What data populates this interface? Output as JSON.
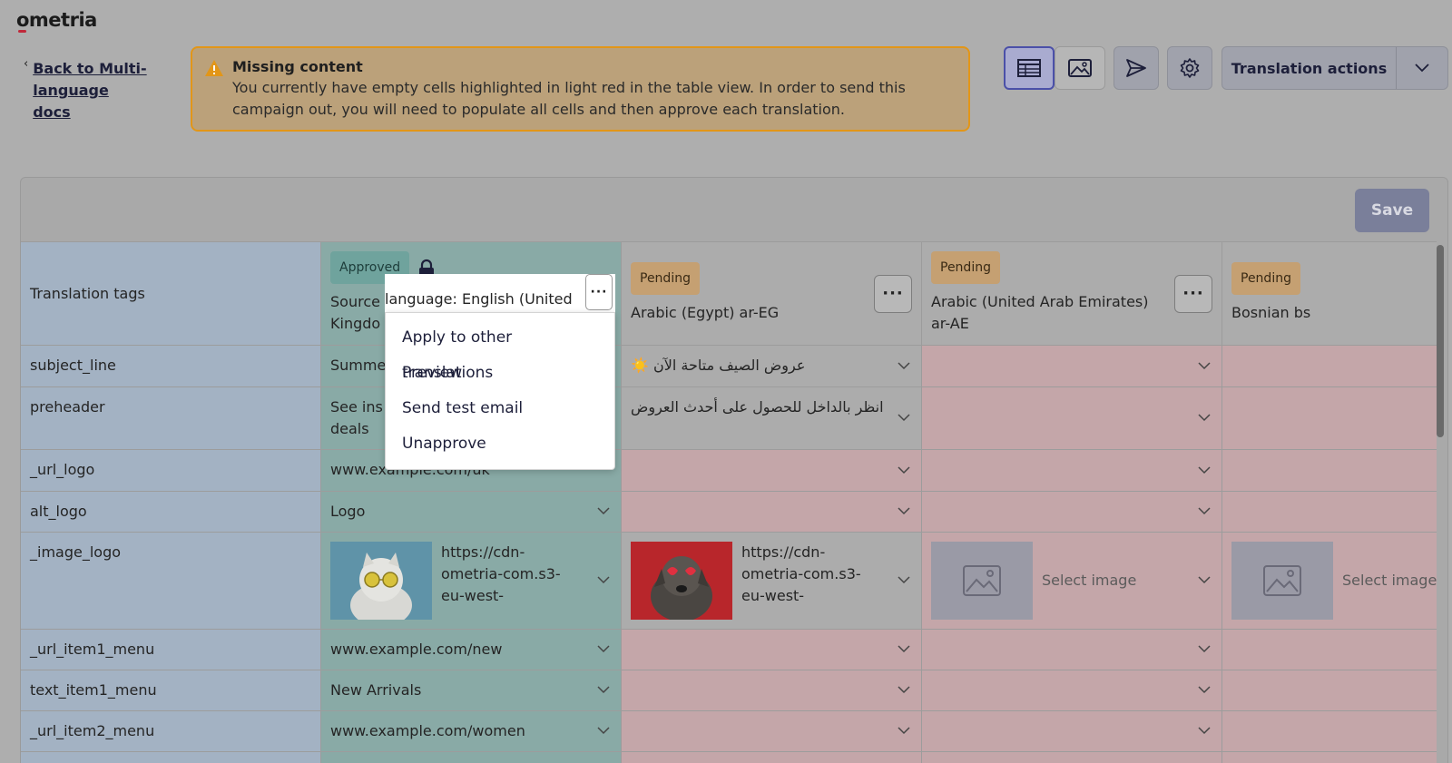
{
  "brand": "ometria",
  "back_link": "Back to Multi-language docs",
  "alert": {
    "title": "Missing content",
    "body": "You currently have empty cells highlighted in light red in the table view. In order to send this campaign out, you will need to populate all cells and then approve each translation."
  },
  "toolbar": {
    "table_view_icon": "table-icon",
    "image_view_icon": "image-icon",
    "send_icon": "send-icon",
    "settings_icon": "gear-icon",
    "translation_actions_label": "Translation actions"
  },
  "save_label": "Save",
  "table": {
    "tags_header": "Translation tags",
    "columns": [
      {
        "status": "Approved",
        "name": "Source language: English (United Kingdom)",
        "name_visible": "Source",
        "name_visible_line2": "Kingdo"
      },
      {
        "status": "Pending",
        "name": "Arabic (Egypt) ar-EG"
      },
      {
        "status": "Pending",
        "name": "Arabic (United Arab Emirates) ar-AE"
      },
      {
        "status": "Pending",
        "name": "Bosnian bs"
      }
    ],
    "rows": [
      {
        "tag": "subject_line",
        "source": "Summe",
        "ar_eg": "عروض الصيف متاحة الآن ☀️",
        "ar_ae": "",
        "bs": ""
      },
      {
        "tag": "preheader",
        "source": "See ins",
        "source_line2": "deals",
        "ar_eg": "انظر بالداخل للحصول على أحدث العروض",
        "ar_ae": "",
        "bs": ""
      },
      {
        "tag": "_url_logo",
        "source": "www.example.com/uk",
        "ar_eg": "",
        "ar_ae": "",
        "bs": ""
      },
      {
        "tag": "alt_logo",
        "source": "Logo",
        "ar_eg": "",
        "ar_ae": "",
        "bs": ""
      },
      {
        "tag": "_image_logo",
        "source": "https://cdn-ometria-com.s3-eu-west-",
        "ar_eg": "https://cdn-ometria-com.s3-eu-west-",
        "ar_ae": "Select image",
        "bs": "Select image"
      },
      {
        "tag": "_url_item1_menu",
        "source": "www.example.com/new",
        "ar_eg": "",
        "ar_ae": "",
        "bs": ""
      },
      {
        "tag": "text_item1_menu",
        "source": "New Arrivals",
        "ar_eg": "",
        "ar_ae": "",
        "bs": ""
      },
      {
        "tag": "_url_item2_menu",
        "source": "www.example.com/women",
        "ar_eg": "",
        "ar_ae": "",
        "bs": ""
      }
    ]
  },
  "context_menu": {
    "anchor_text": "language: English (United",
    "items": [
      "Apply to other translations",
      "Preview",
      "Send test email",
      "Unapprove"
    ]
  },
  "colors": {
    "approved": "#6fa39d",
    "pending": "#c5a072",
    "missing_cell": "#c4a6a9",
    "accent": "#4b50a8",
    "warning_border": "#e29618"
  }
}
